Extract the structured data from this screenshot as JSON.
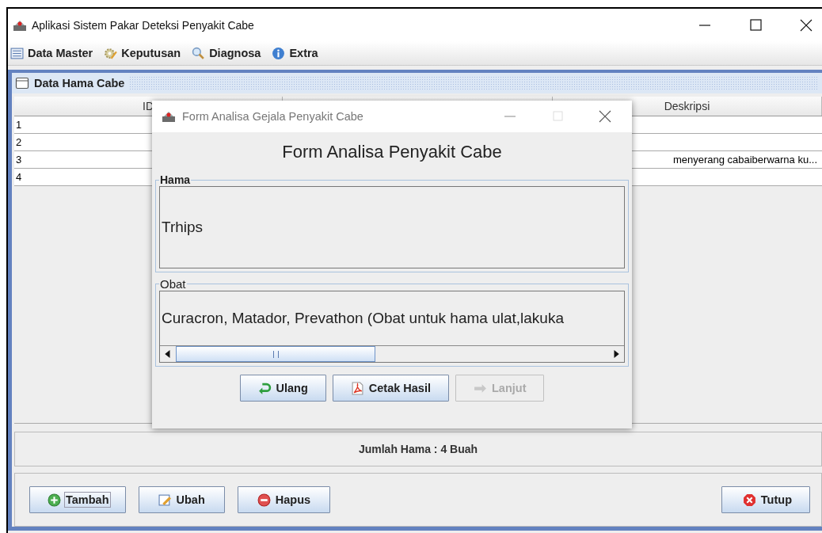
{
  "window": {
    "title": "Aplikasi Sistem Pakar Deteksi Penyakit Cabe"
  },
  "menu": [
    {
      "label": "Data Master",
      "kind": "list"
    },
    {
      "label": "Keputusan",
      "kind": "gear"
    },
    {
      "label": "Diagnosa",
      "kind": "search"
    },
    {
      "label": "Extra",
      "kind": "info"
    }
  ],
  "internal_frame": {
    "title": "Data Hama Cabe"
  },
  "table": {
    "columns": [
      {
        "label": "ID",
        "kind": "text"
      },
      {
        "kind": "hidden"
      },
      {
        "label": "Deskripsi",
        "kind": "text"
      }
    ],
    "rows": [
      {
        "id": "1"
      },
      {
        "id": "2"
      },
      {
        "id": "3",
        "deskripsi": "menyerang cabaiberwarna ku..."
      },
      {
        "id": "4"
      }
    ]
  },
  "summary": "Jumlah Hama : 4 Buah",
  "buttons": [
    {
      "label": "Tambah",
      "kind": "add",
      "focused": true
    },
    {
      "label": "Ubah",
      "kind": "edit",
      "focused": false
    },
    {
      "label": "Hapus",
      "kind": "remove",
      "focused": false
    },
    {
      "label": "Tutup",
      "kind": "close",
      "focused": false
    }
  ],
  "dialog": {
    "title": "Form Analisa Gejala Penyakit Cabe",
    "heading": "Form Analisa Penyakit Cabe",
    "hama": {
      "legend": "Hama",
      "value": "Trhips"
    },
    "obat": {
      "legend": "Obat",
      "value": "Curacron, Matador, Prevathon (Obat untuk hama ulat,lakuka"
    },
    "buttons": [
      {
        "label": "Ulang",
        "kind": "reset",
        "disabled": false
      },
      {
        "label": "Cetak Hasil",
        "kind": "pdf",
        "disabled": false
      },
      {
        "label": "Lanjut",
        "kind": "next",
        "disabled": true
      }
    ]
  }
}
